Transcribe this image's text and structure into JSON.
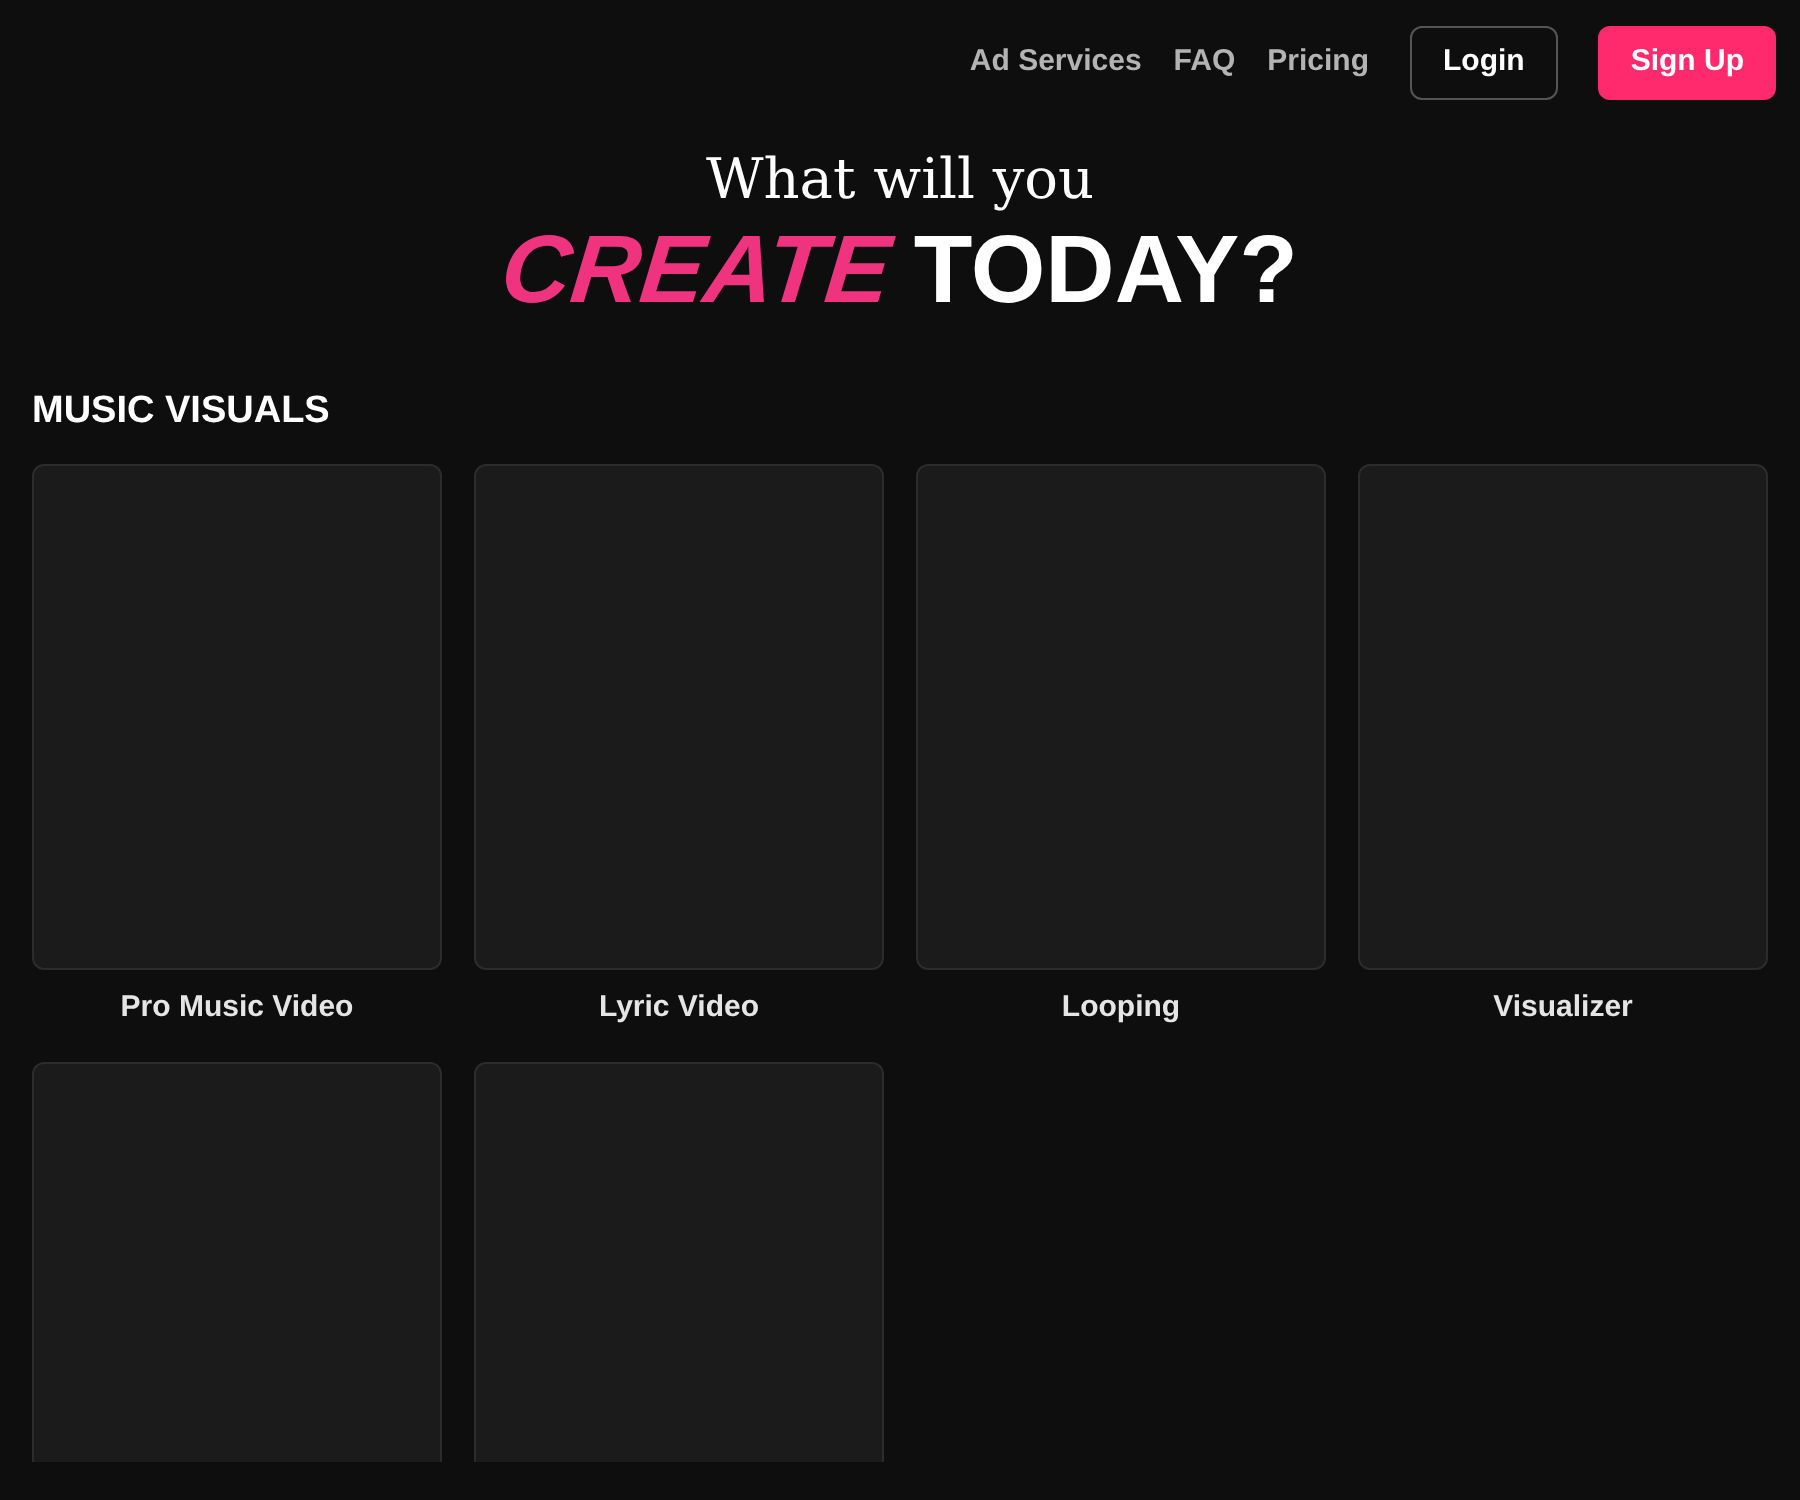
{
  "nav": {
    "links": [
      "Ad Services",
      "FAQ",
      "Pricing"
    ],
    "login": "Login",
    "signup": "Sign Up"
  },
  "hero": {
    "line1": "What will you",
    "accent": "CREATE",
    "rest": "TODAY?"
  },
  "section": {
    "title": "MUSIC VISUALS",
    "cards": [
      {
        "kind": "labeled",
        "label": "Pro Music Video"
      },
      {
        "kind": "labeled",
        "label": "Lyric Video"
      },
      {
        "kind": "labeled",
        "label": "Looping"
      },
      {
        "kind": "labeled",
        "label": "Visualizer"
      },
      {
        "kind": "cut"
      },
      {
        "kind": "cut"
      }
    ]
  }
}
